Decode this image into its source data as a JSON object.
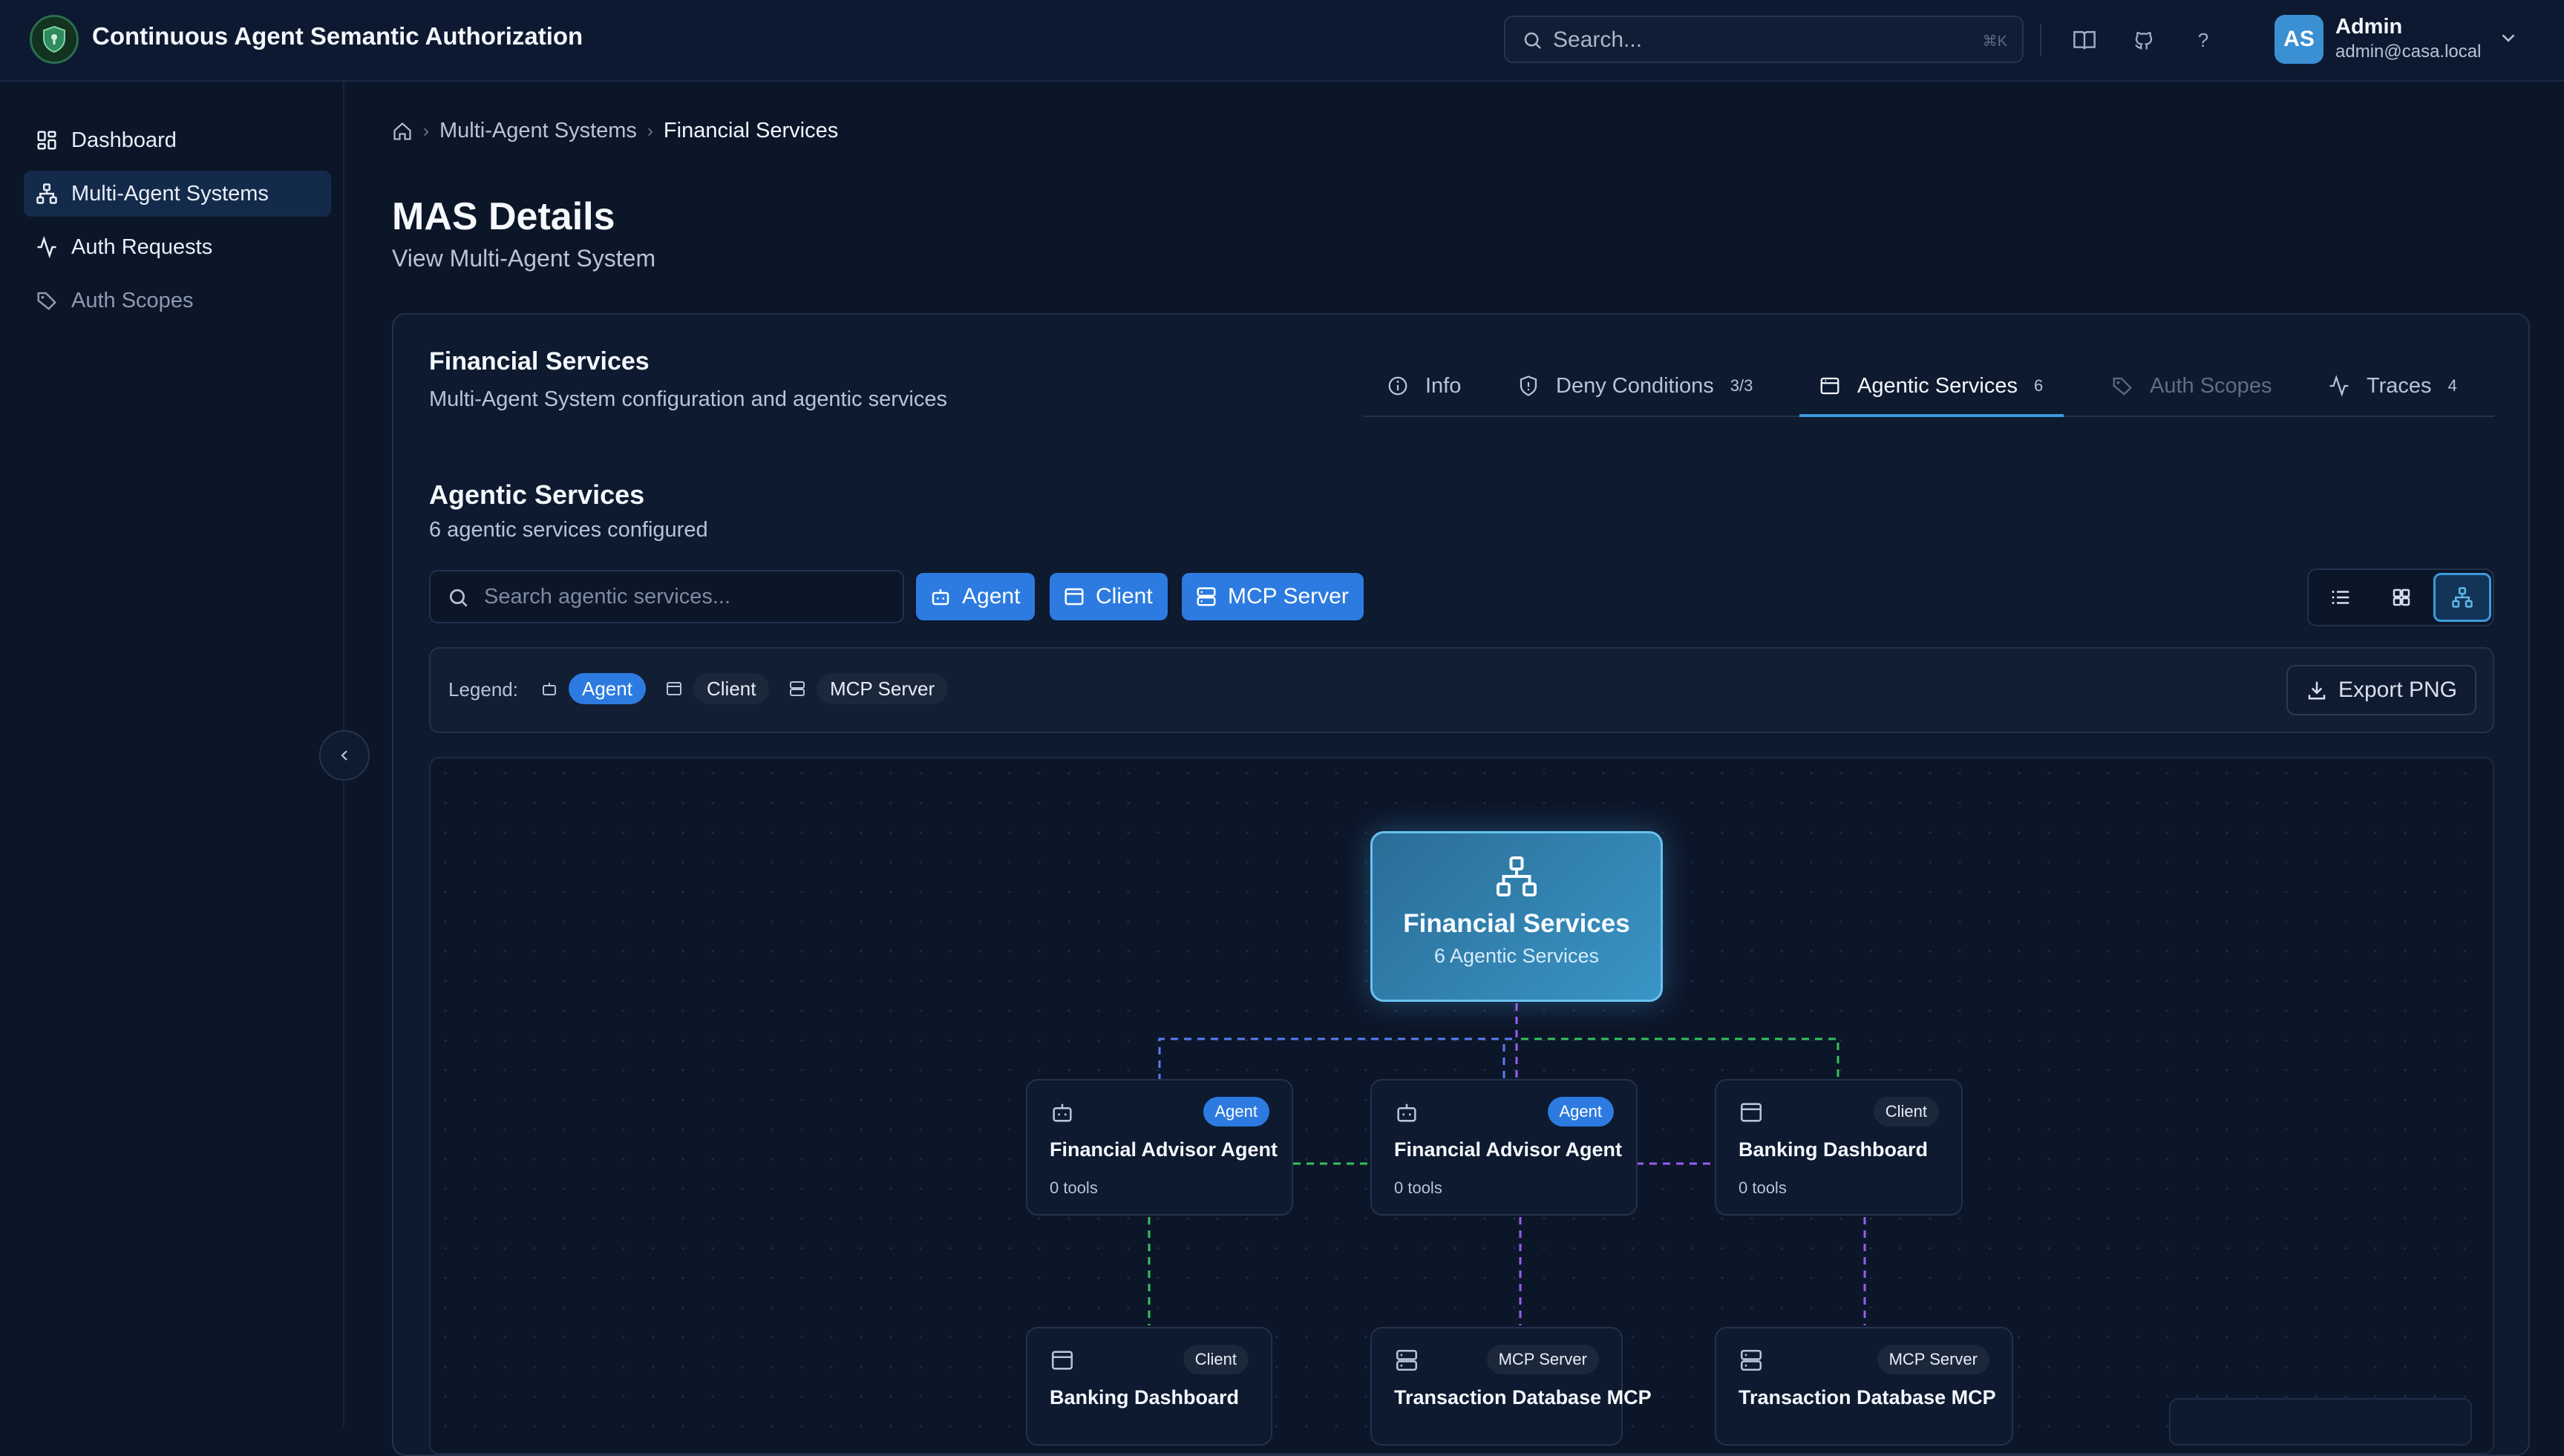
{
  "app": {
    "title": "Continuous Agent Semantic Authorization"
  },
  "header": {
    "search_placeholder": "Search...",
    "search_shortcut": "⌘K",
    "icons": [
      "book-icon",
      "github-icon",
      "help-icon"
    ],
    "help_label": "?",
    "user": {
      "initials": "AS",
      "name": "Admin",
      "email": "admin@casa.local"
    }
  },
  "sidebar": {
    "items": [
      {
        "label": "Dashboard",
        "icon": "grid-icon",
        "active": false
      },
      {
        "label": "Multi-Agent Systems",
        "icon": "network-icon",
        "active": true
      },
      {
        "label": "Auth Requests",
        "icon": "activity-icon",
        "active": false
      },
      {
        "label": "Auth Scopes",
        "icon": "tag-icon",
        "active": false
      }
    ]
  },
  "breadcrumb": {
    "items": [
      "Multi-Agent Systems",
      "Financial Services"
    ]
  },
  "page": {
    "title": "MAS Details",
    "subtitle": "View Multi-Agent System"
  },
  "card": {
    "title": "Financial Services",
    "description": "Multi-Agent System configuration and agentic services",
    "tabs": [
      {
        "label": "Info",
        "count": ""
      },
      {
        "label": "Deny Conditions",
        "count": "3/3"
      },
      {
        "label": "Agentic Services",
        "count": "6",
        "active": true
      },
      {
        "label": "Auth Scopes",
        "count": "",
        "disabled": true
      },
      {
        "label": "Traces",
        "count": "4"
      }
    ]
  },
  "services": {
    "title": "Agentic Services",
    "subtitle": "6 agentic services configured",
    "search_placeholder": "Search agentic services...",
    "filters": [
      "Agent",
      "Client",
      "MCP Server"
    ],
    "legend_label": "Legend:",
    "legend": [
      "Agent",
      "Client",
      "MCP Server"
    ],
    "export_label": "Export PNG"
  },
  "graph": {
    "root": {
      "title": "Financial Services",
      "subtitle": "6 Agentic Services"
    },
    "nodes": [
      {
        "title": "Financial Advisor Agent",
        "type": "Agent",
        "tools": "0 tools"
      },
      {
        "title": "Financial Advisor Agent",
        "type": "Agent",
        "tools": "0 tools"
      },
      {
        "title": "Banking Dashboard",
        "type": "Client",
        "tools": "0 tools"
      },
      {
        "title": "Banking Dashboard",
        "type": "Client"
      },
      {
        "title": "Transaction Database MCP",
        "type": "MCP Server"
      },
      {
        "title": "Transaction Database MCP",
        "type": "MCP Server"
      }
    ],
    "colors": {
      "agent_edge": "#5b7cf0",
      "client_edge": "#37c15d",
      "mcp_edge": "#9b5cf0"
    }
  },
  "colors": {
    "accent": "#2d7be0",
    "background": "#0b1628",
    "root_node": "#3a95c6"
  }
}
